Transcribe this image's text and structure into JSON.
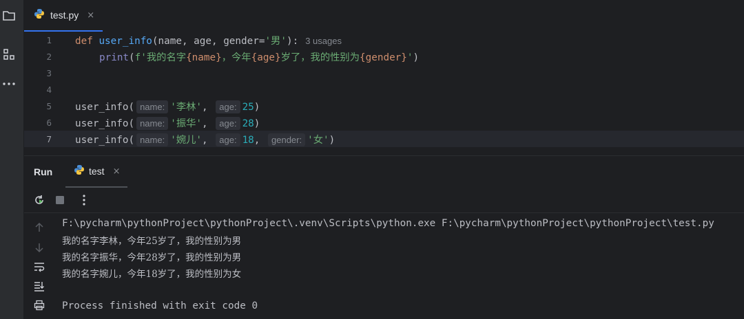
{
  "editor_tab": {
    "filename": "test.py",
    "close": "×"
  },
  "code": {
    "line_numbers": [
      "1",
      "2",
      "3",
      "4",
      "5",
      "6",
      "7"
    ],
    "line1": {
      "def": "def",
      "fname": "user_info",
      "open": "(name, age, gender=",
      "default": "'男'",
      "close": "):",
      "usages": "3 usages"
    },
    "line2": {
      "print": "print",
      "open": "(",
      "fprefix": "f'",
      "s1": "我的名字",
      "v1": "{name}",
      "s2": "，今年",
      "v2": "{age}",
      "s3": "岁了，我的性别为",
      "v3": "{gender}",
      "fsuffix": "'",
      "close": ")"
    },
    "line5": {
      "call": "user_info(",
      "hint_name": "name:",
      "arg_name": "'李林'",
      "sep1": ",",
      "hint_age": "age:",
      "arg_age": "25",
      "close": ")"
    },
    "line6": {
      "call": "user_info(",
      "hint_name": "name:",
      "arg_name": "'振华'",
      "sep1": ",",
      "hint_age": "age:",
      "arg_age": "28",
      "close": ")"
    },
    "line7": {
      "call": "user_info(",
      "hint_name": "name:",
      "arg_name": "'婉儿'",
      "sep1": ",",
      "hint_age": "age:",
      "arg_age": "18",
      "sep2": ",",
      "hint_gender": "gender:",
      "arg_gender": "'女'",
      "close": ")"
    }
  },
  "run_panel": {
    "title": "Run",
    "tab_label": "test",
    "tab_close": "×",
    "console": {
      "command": "F:\\pycharm\\pythonProject\\pythonProject\\.venv\\Scripts\\python.exe F:\\pycharm\\pythonProject\\pythonProject\\test.py",
      "out1": "我的名字李林，今年25岁了，我的性别为男",
      "out2": "我的名字振华，今年28岁了，我的性别为男",
      "out3": "我的名字婉儿，今年18岁了，我的性别为女",
      "exit": "Process finished with exit code 0"
    }
  },
  "colors": {
    "accent": "#3574f0",
    "keyword": "#cf8e6d",
    "function": "#56a8f5",
    "string": "#6aab73",
    "number": "#2aacb8"
  },
  "icons": [
    "folder-icon",
    "structure-icon",
    "more-icon",
    "python-file-icon",
    "rerun-icon",
    "stop-icon",
    "more-vertical-icon",
    "scroll-up-icon",
    "scroll-down-icon",
    "soft-wrap-icon",
    "scroll-to-end-icon",
    "print-icon"
  ]
}
